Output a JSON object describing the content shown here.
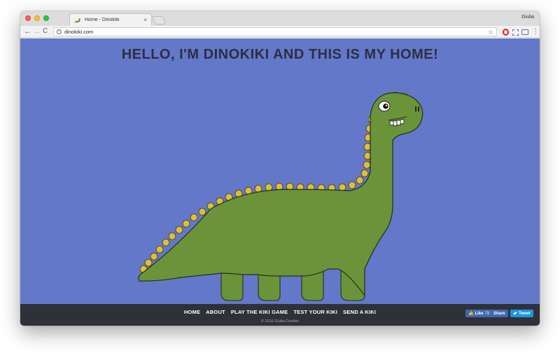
{
  "browser": {
    "tab_title": "Home - Dinokiki",
    "tab_close_icon": "×",
    "profile_name": "Giulia",
    "url": "dinokiki.com",
    "nav": {
      "back": "←",
      "forward": "→",
      "reload": "C"
    },
    "star_icon": "☆",
    "menu_icon": "⋮",
    "info_icon": "i"
  },
  "page": {
    "headline": "HELLO, I'M DINOKIKI AND THIS IS MY HOME!",
    "colors": {
      "background": "#6478c9",
      "dino_body": "#6b9339",
      "dino_spikes": "#e0bd35",
      "footer": "#2f3139"
    }
  },
  "footer": {
    "links": [
      "HOME",
      "ABOUT",
      "PLAY THE KIKI GAME",
      "TEST YOUR KIKI",
      "SEND A KIKI"
    ],
    "copyright": "© 2016 Giulia Cardieri",
    "social": {
      "fb_like_label": "Like",
      "fb_like_count": "78",
      "fb_share_label": "Share",
      "tweet_label": "Tweet"
    }
  }
}
